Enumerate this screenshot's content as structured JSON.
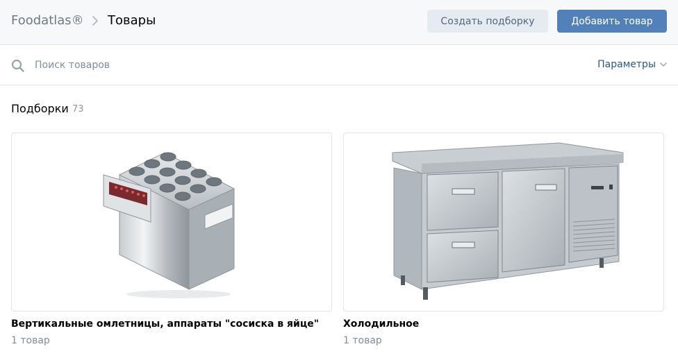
{
  "header": {
    "breadcrumb_root": "Foodatlas®",
    "breadcrumb_current": "Товары",
    "create_collection_label": "Создать подборку",
    "add_product_label": "Добавить товар"
  },
  "search": {
    "placeholder": "Поиск товаров",
    "value": "",
    "params_label": "Параметры"
  },
  "collections": {
    "title": "Подборки",
    "count": "73",
    "items": [
      {
        "title": "Вертикальные омлетницы, аппараты \"сосиска в яйце\"",
        "count_label": "1 товар",
        "image": "egg-roll-machine"
      },
      {
        "title": "Холодильное",
        "count_label": "1 товар",
        "image": "refrigerated-counter"
      }
    ]
  },
  "colors": {
    "accent": "#5181b8",
    "secondary_button": "#e5ebf1",
    "link": "#2a5885",
    "muted": "#818c99"
  }
}
